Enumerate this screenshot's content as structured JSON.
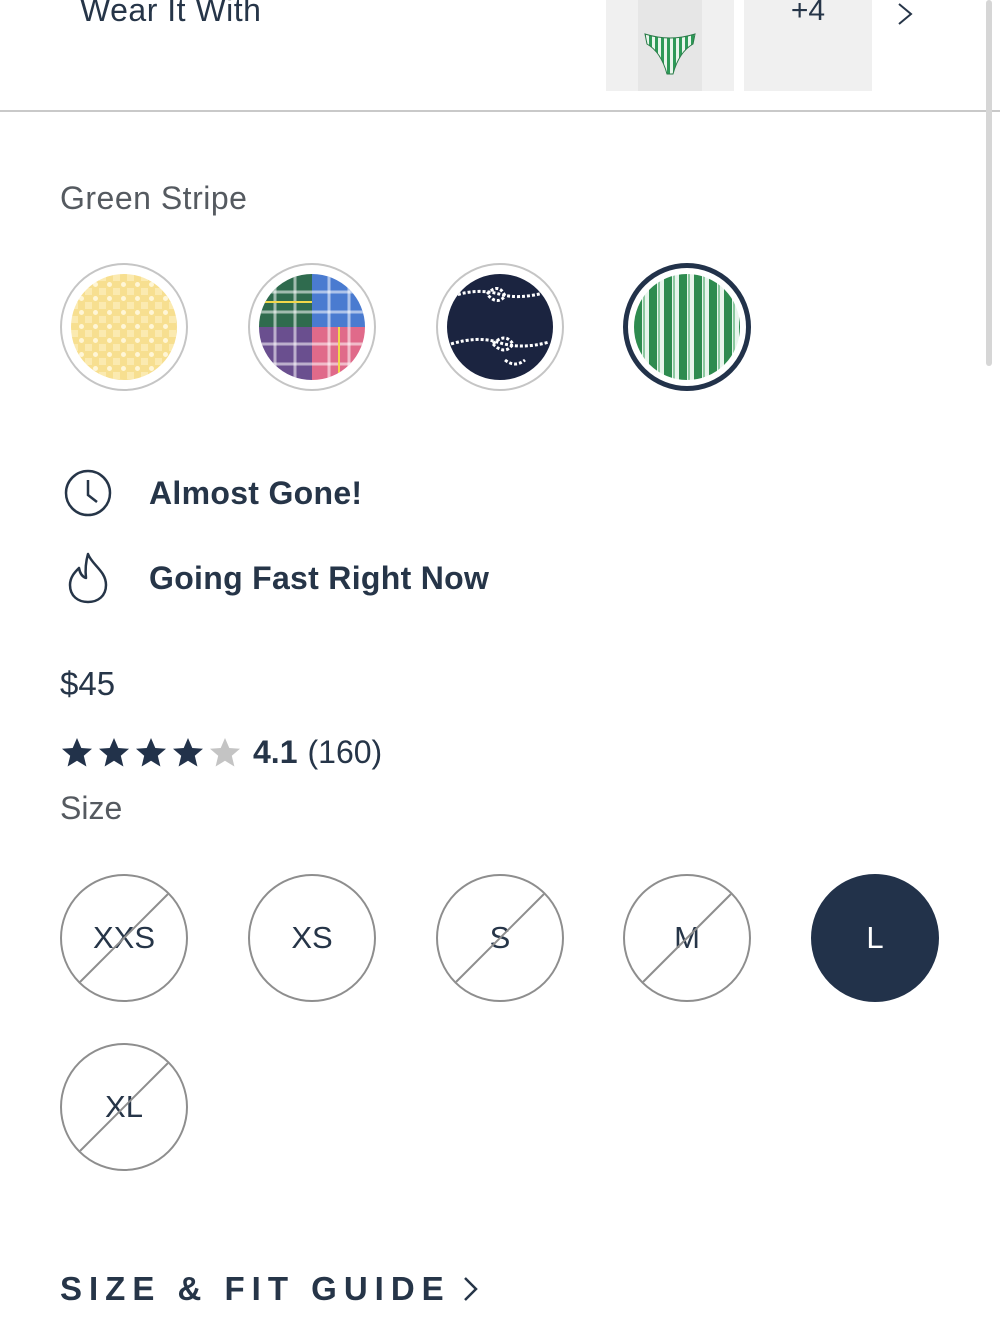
{
  "wear_it_with": {
    "label": "Wear It With",
    "more_count": "+4"
  },
  "color": {
    "selected_name": "Green Stripe",
    "swatches": [
      {
        "name": "yellow-seersucker",
        "selected": false
      },
      {
        "name": "madras-patchwork",
        "selected": false
      },
      {
        "name": "navy-rope",
        "selected": false
      },
      {
        "name": "green-stripe",
        "selected": true
      }
    ]
  },
  "badges": {
    "almost_gone": "Almost Gone!",
    "going_fast": "Going Fast Right Now"
  },
  "price": "$45",
  "rating": {
    "value": "4.1",
    "count": "(160)",
    "stars": 4.1,
    "max": 5
  },
  "size": {
    "label": "Size",
    "options": [
      {
        "label": "XXS",
        "available": false,
        "selected": false
      },
      {
        "label": "XS",
        "available": true,
        "selected": false
      },
      {
        "label": "S",
        "available": false,
        "selected": false
      },
      {
        "label": "M",
        "available": false,
        "selected": false
      },
      {
        "label": "L",
        "available": true,
        "selected": true
      },
      {
        "label": "XL",
        "available": false,
        "selected": false
      }
    ]
  },
  "size_guide": {
    "label": "SIZE & FIT GUIDE"
  },
  "colors": {
    "navy": "#263548",
    "selected_navy": "#22324a",
    "star_filled": "#22324a",
    "star_empty": "#c4c4c4",
    "stripe_green": "#2e8b4f"
  },
  "icons": {
    "clock": "clock-icon",
    "flame": "flame-icon",
    "star": "star-icon",
    "chevron": "chevron-right-icon"
  }
}
